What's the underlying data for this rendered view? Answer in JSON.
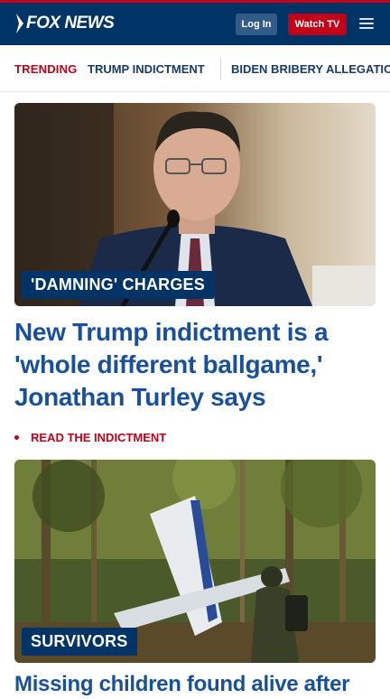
{
  "header": {
    "logo_text": "FOX NEWS",
    "login_label": "Log In",
    "watch_label": "Watch TV",
    "menu_icon": "hamburger-menu-icon",
    "colors": {
      "navy": "#003366",
      "red": "#c20017"
    }
  },
  "trending": {
    "label": "TRENDING",
    "items": [
      "TRUMP INDICTMENT",
      "BIDEN BRIBERY ALLEGATIO"
    ]
  },
  "stories": [
    {
      "kicker": "'DAMNING' CHARGES",
      "image": "man in suit speaking at hearing microphone",
      "headline": "New Trump indictment is a 'whole different ballgame,' Jonathan Turley says",
      "related": "READ THE INDICTMENT"
    },
    {
      "kicker": "SURVIVORS",
      "image": "small plane wreckage in jungle with soldier",
      "headline": "Missing children found alive after"
    }
  ]
}
